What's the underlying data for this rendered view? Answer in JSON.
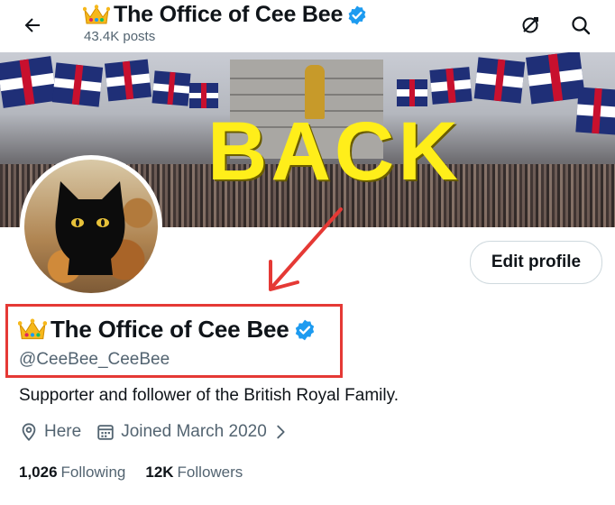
{
  "header": {
    "title": "The Office of Cee Bee",
    "posts": "43.4K posts"
  },
  "banner": {
    "overlay_text": "BACK"
  },
  "profile": {
    "edit_profile_label": "Edit profile",
    "display_name": "The Office of Cee Bee",
    "handle": "@CeeBee_CeeBee",
    "bio": "Supporter and follower of the British Royal Family.",
    "location": "Here",
    "joined": "Joined March 2020",
    "following_count": "1,026",
    "following_label": "Following",
    "followers_count": "12K",
    "followers_label": "Followers"
  },
  "icons": {
    "back": "arrow-left-icon",
    "crown": "crown-icon",
    "verified": "verified-badge-icon",
    "refresh": "circle-slash-icon",
    "search": "search-icon",
    "location": "location-pin-icon",
    "calendar": "calendar-icon",
    "chevron": "chevron-right-icon"
  },
  "colors": {
    "verified_blue": "#1d9bf0",
    "highlight_red": "#e53935",
    "banner_text_yellow": "#ffee1a",
    "secondary_text": "#536471"
  }
}
